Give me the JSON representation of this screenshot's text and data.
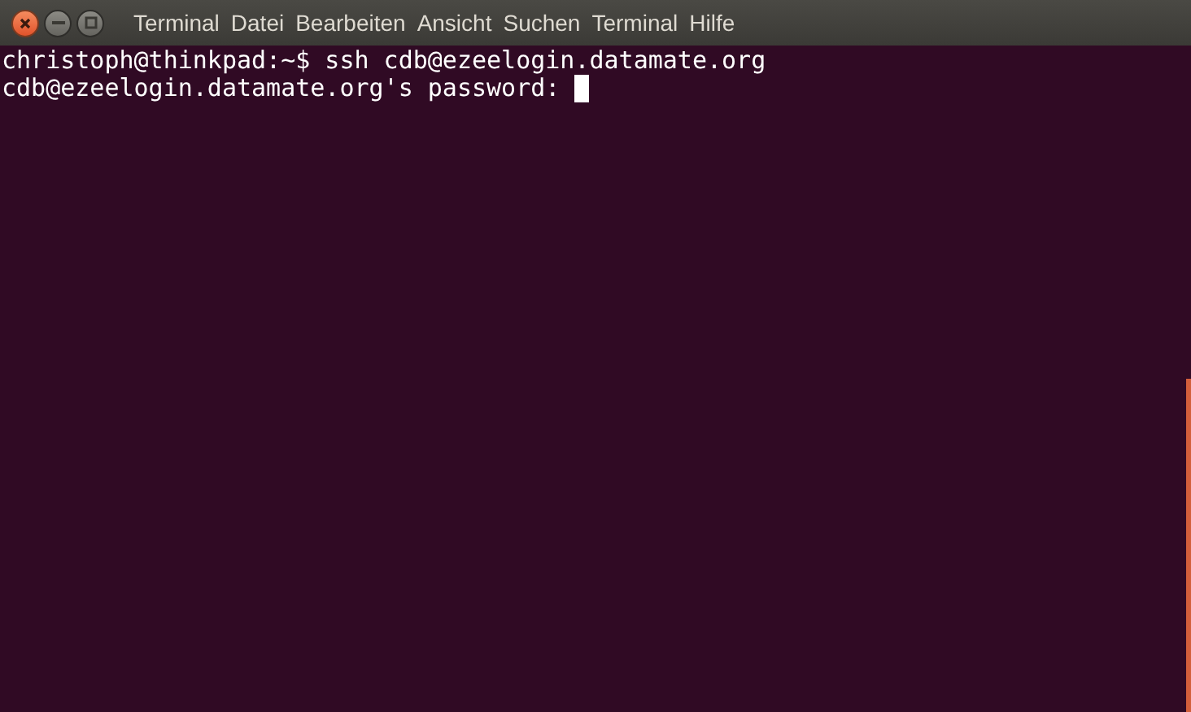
{
  "menu": [
    {
      "label": "Terminal"
    },
    {
      "label": "Datei"
    },
    {
      "label": "Bearbeiten"
    },
    {
      "label": "Ansicht"
    },
    {
      "label": "Suchen"
    },
    {
      "label": "Terminal"
    },
    {
      "label": "Hilfe"
    }
  ],
  "terminal": {
    "lines": [
      "christoph@thinkpad:~$ ssh cdb@ezeelogin.datamate.org",
      "cdb@ezeelogin.datamate.org's password: "
    ],
    "cursor": true
  }
}
